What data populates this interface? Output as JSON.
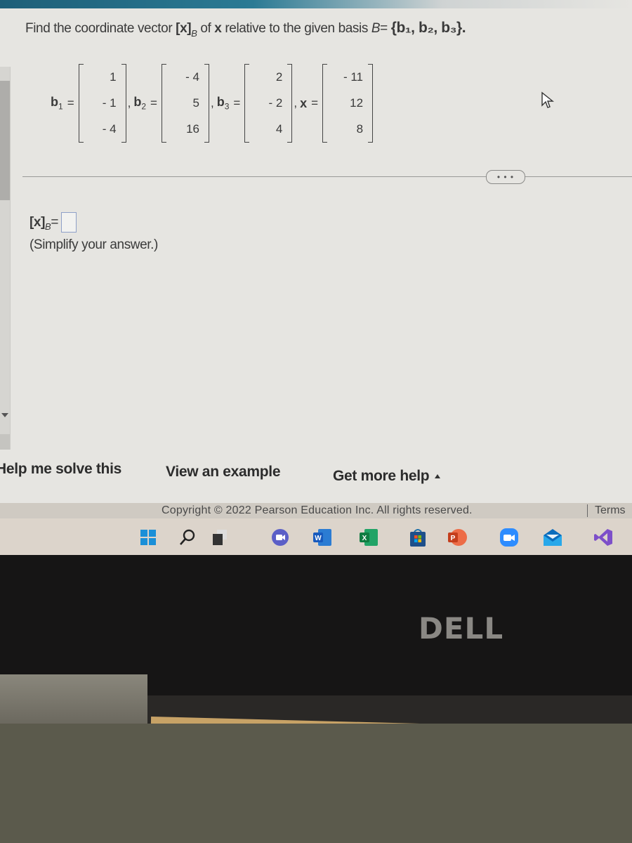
{
  "question": {
    "prefix": "Find the coordinate vector ",
    "xb_bracket": "[x]",
    "xb_sub": "B",
    "middle": " of ",
    "x_bold": "x",
    "suffix": " relative to the given basis ",
    "basis_name": "B",
    "basis_eq": "= ",
    "basis_set": "{b₁, b₂, b₃}."
  },
  "vectors": [
    {
      "label": "b",
      "sub": "1",
      "values": [
        "1",
        "- 1",
        "- 4"
      ]
    },
    {
      "label": "b",
      "sub": "2",
      "values": [
        "- 4",
        "5",
        "16"
      ]
    },
    {
      "label": "b",
      "sub": "3",
      "values": [
        "2",
        "- 2",
        "4"
      ]
    },
    {
      "label": "x",
      "sub": "",
      "values": [
        "- 11",
        "12",
        "8"
      ]
    }
  ],
  "more_button_label": "• • •",
  "answer": {
    "label": "[x]",
    "sub": "B",
    "eq": " =",
    "value": "",
    "hint": "(Simplify your answer.)"
  },
  "help": {
    "solve": "Help me solve this",
    "example": "View an example",
    "more": "Get more help"
  },
  "footer": {
    "copyright": "Copyright © 2022 Pearson Education Inc. All rights reserved.",
    "terms": "Terms"
  },
  "taskbar": {
    "icons": [
      "windows-start",
      "search",
      "task-view",
      "teams-chat",
      "word",
      "excel",
      "microsoft-store",
      "powerpoint",
      "zoom",
      "mail",
      "visual-studio"
    ],
    "colors": {
      "accent": "#0f6cbd",
      "word": "#185abd",
      "excel": "#107c41",
      "powerpoint": "#d35230",
      "zoom": "#2d8cff",
      "vs": "#7d4fc9"
    }
  },
  "monitor_brand": "DELL"
}
